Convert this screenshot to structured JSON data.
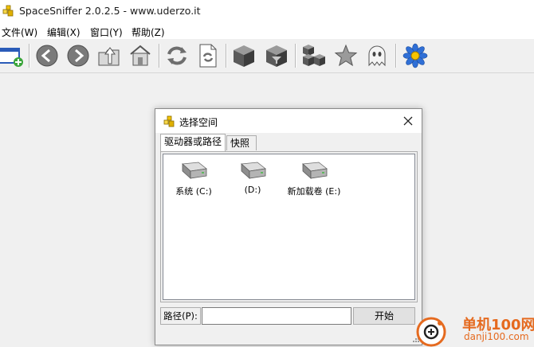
{
  "window": {
    "title": "SpaceSniffer 2.0.2.5 - www.uderzo.it"
  },
  "menu": [
    {
      "label": "文件(W)"
    },
    {
      "label": "编辑(X)"
    },
    {
      "label": "窗口(Y)"
    },
    {
      "label": "帮助(Z)"
    }
  ],
  "toolbar": {
    "buttons": [
      "new-space-icon",
      "back-icon",
      "forward-icon",
      "up-folder-icon",
      "home-icon",
      "refresh-icon",
      "rescan-document-icon",
      "cube-dark-icon",
      "cube-filter-icon",
      "cubes-group-icon",
      "star-icon",
      "ghost-icon",
      "blue-flower-icon"
    ]
  },
  "dialog": {
    "title": "选择空间",
    "tabs": [
      {
        "label": "驱动器或路径"
      },
      {
        "label": "快照"
      }
    ],
    "drives": [
      {
        "label": "系统 (C:)"
      },
      {
        "label": "(D:)"
      },
      {
        "label": "新加载卷 (E:)"
      }
    ],
    "path_label": "路径(P):",
    "path_value": "",
    "start_label": "开始"
  },
  "watermark": {
    "name": "单机100网",
    "url": "danji100.com"
  },
  "colors": {
    "watermark": "#e56a1f",
    "toolbar_icon_gray": "#6e6e6e",
    "flower_blue": "#2f6fd6"
  }
}
